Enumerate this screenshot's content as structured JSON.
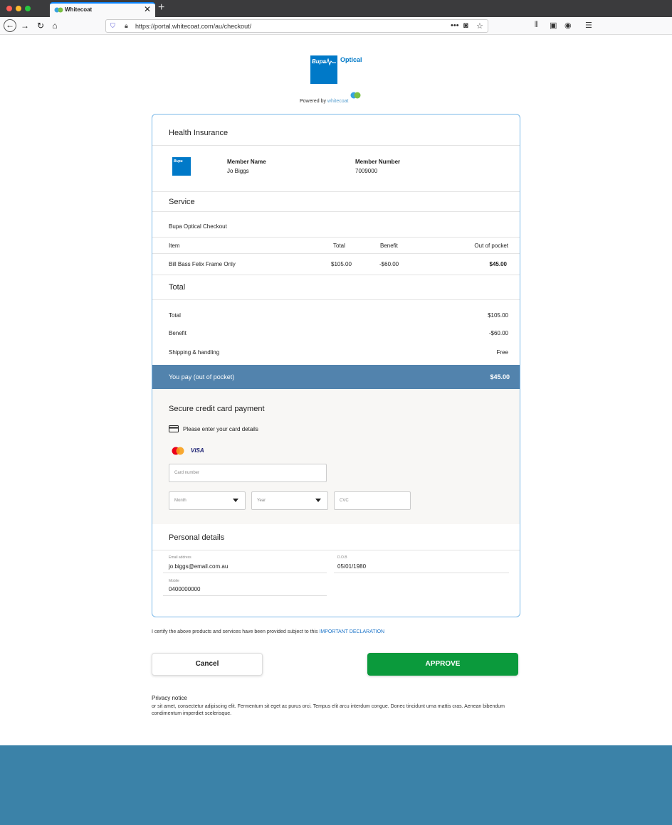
{
  "browser": {
    "tab_title": "Whitecoat",
    "url": "https://portal.whitecoat.com/au/checkout/",
    "tab_close": "✕",
    "new_tab": "+"
  },
  "branding": {
    "logo_word": "Bupa",
    "logo_product": "Optical",
    "powered_by": "Powered by",
    "powered_brand": "whitecoat"
  },
  "health_insurance": {
    "heading": "Health Insurance",
    "mini_logo_word": "Bupa",
    "member_name_label": "Member Name",
    "member_name": "Jo Biggs",
    "member_number_label": "Member Number",
    "member_number": "7009000"
  },
  "service": {
    "heading": "Service",
    "name": "Bupa Optical Checkout",
    "columns": {
      "item": "Item",
      "total": "Total",
      "benefit": "Benefit",
      "out_of_pocket": "Out of pocket"
    },
    "items": [
      {
        "item": "Bill Bass Felix Frame Only",
        "total": "$105.00",
        "benefit": "-$60.00",
        "out_of_pocket": "$45.00"
      }
    ]
  },
  "totals": {
    "heading": "Total",
    "rows": [
      {
        "label": "Total",
        "value": "$105.00"
      },
      {
        "label": "Benefit",
        "value": "-$60.00"
      },
      {
        "label": "Shipping & handling",
        "value": "Free"
      }
    ],
    "you_pay_label": "You pay (out of pocket)",
    "you_pay_value": "$45.00"
  },
  "payment": {
    "heading": "Secure credit card payment",
    "instruction": "Please enter your card details",
    "visa": "VISA",
    "card_number_placeholder": "Card number",
    "month_placeholder": "Month",
    "year_placeholder": "Year",
    "cvc_placeholder": "CVC"
  },
  "personal": {
    "heading": "Personal details",
    "email_label": "Email address",
    "email": "jo.biggs@email.com.au",
    "dob_label": "D.O.B",
    "dob": "05/01/1980",
    "mobile_label": "Mobile",
    "mobile": "0400000000"
  },
  "declaration": {
    "text": "I certify the above products and services have been provided subject to this",
    "link": "IMPORTANT DECLARATION"
  },
  "actions": {
    "cancel": "Cancel",
    "approve": "APPROVE"
  },
  "privacy": {
    "heading": "Privacy notice",
    "text": "or sit amet, consectetur adipiscing elit. Fermentum sit eget ac purus orci. Tempus elit arcu interdum congue. Donec tincidunt urna mattis cras. Aenean bibendum condimentum imperdiet scelerisque."
  },
  "colors": {
    "brand_blue": "#0079c8",
    "pay_bar": "#5283ad",
    "approve_green": "#0b9a3c",
    "footer": "#3b82a8"
  }
}
